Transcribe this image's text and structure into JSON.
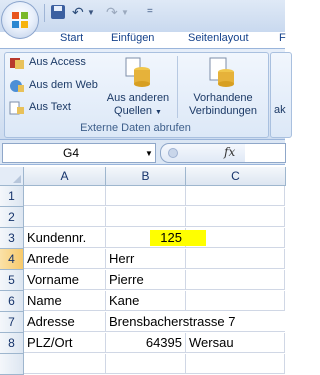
{
  "quick_access": {
    "more": "="
  },
  "tabs": [
    "Start",
    "Einfügen",
    "Seitenlayout",
    "F"
  ],
  "ribbon": {
    "group_label": "Externe Daten abrufen",
    "items": {
      "access": "Aus Access",
      "web": "Aus dem Web",
      "text": "Aus Text",
      "other_sources_line1": "Aus anderen",
      "other_sources_line2": "Quellen",
      "existing_line1": "Vorhandene",
      "existing_line2": "Verbindungen",
      "cut_off": "ak"
    }
  },
  "formula_bar": {
    "name_box": "G4",
    "fx_label": "fx",
    "value": ""
  },
  "sheet": {
    "columns": [
      "A",
      "B",
      "C"
    ],
    "rows": [
      "1",
      "2",
      "3",
      "4",
      "5",
      "6",
      "7",
      "8"
    ],
    "cells": {
      "A3": "Kundennr.",
      "B3": "125",
      "A4": "Anrede",
      "B4": "Herr",
      "A5": "Vorname",
      "B5": "Pierre",
      "A6": "Name",
      "B6": "Kane",
      "A7": "Adresse",
      "B7": "Brensbacherstrasse 7",
      "A8": "PLZ/Ort",
      "B8": "64395",
      "C8": "Wersau"
    },
    "highlight_color": "#ffff00",
    "selected_cell": "G4"
  },
  "colors": {
    "ribbon_text": "#1c3a66",
    "tab_text": "#15428b",
    "header_selected": "#f7c96b"
  }
}
